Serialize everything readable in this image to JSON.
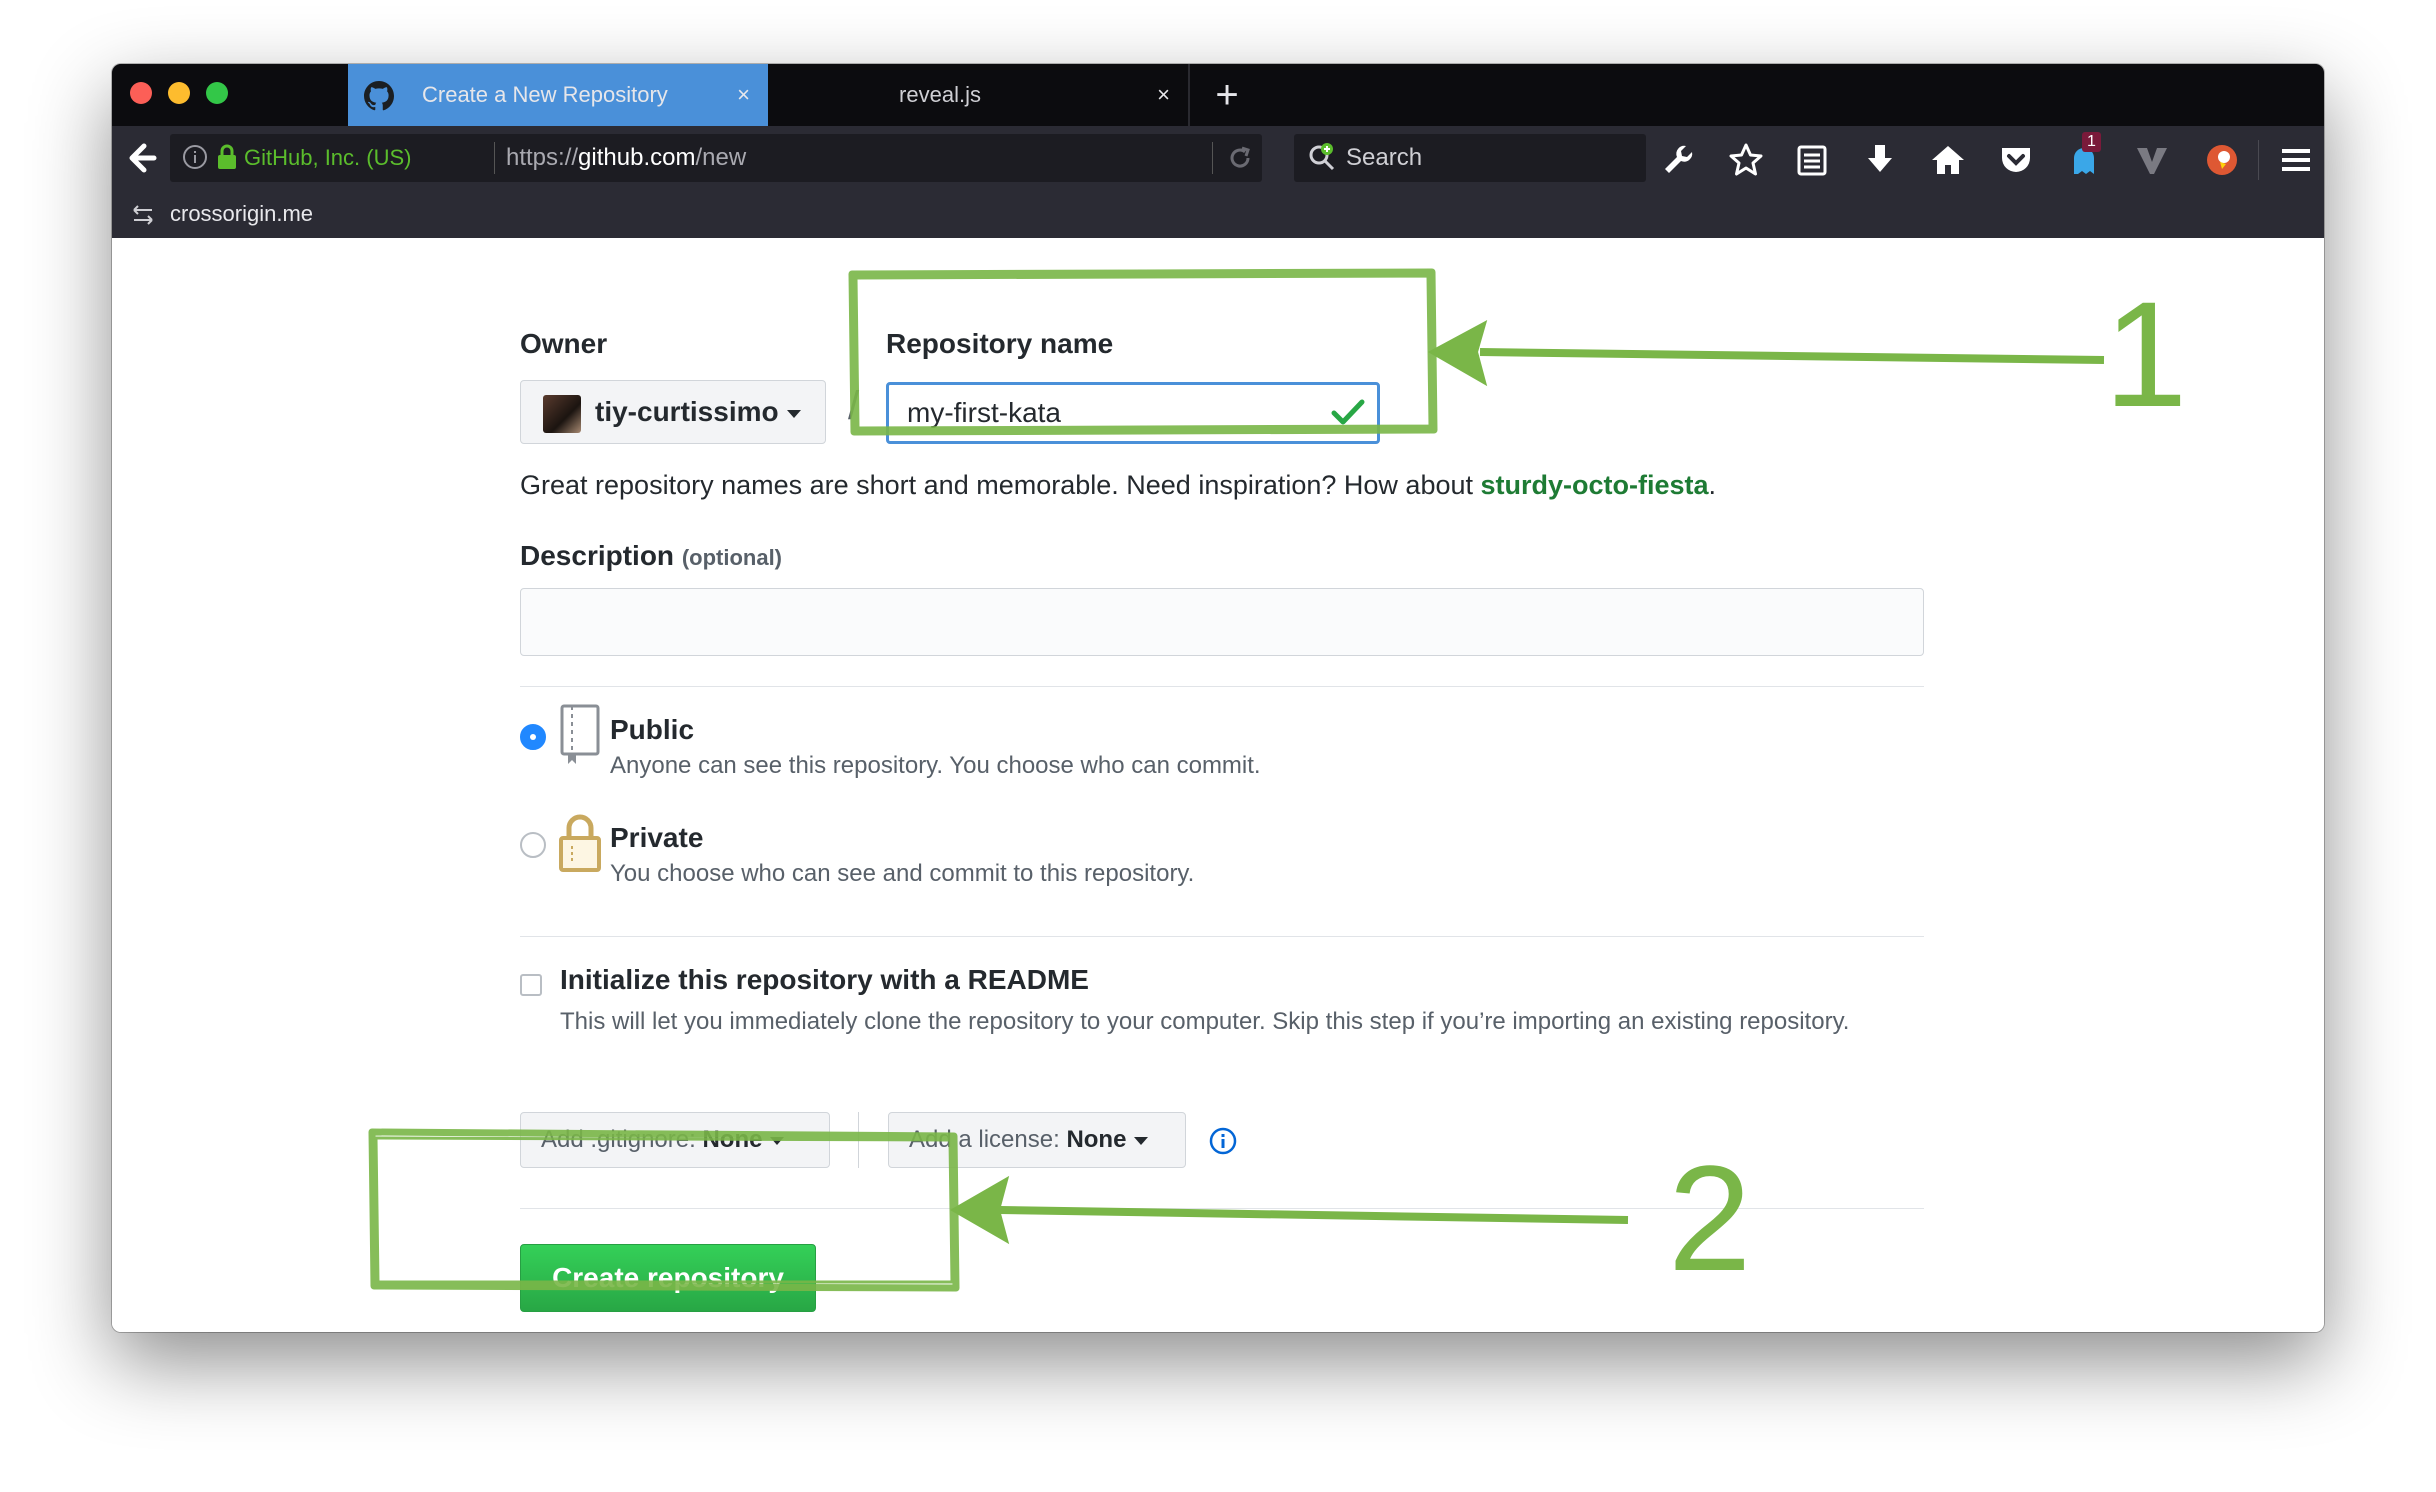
{
  "browser": {
    "tabs": [
      {
        "title": "Create a New Repository",
        "active": true,
        "close": "×"
      },
      {
        "title": "reveal.js",
        "active": false,
        "close": "×"
      }
    ],
    "new_tab": "+",
    "url": {
      "identity": "GitHub, Inc. (US)",
      "prefix": "https://",
      "domain": "github.com",
      "path": "/new"
    },
    "search_placeholder": "Search",
    "badge_count": "1",
    "bookmark": "crossorigin.me"
  },
  "form": {
    "owner_label": "Owner",
    "owner_value": "tiy-curtissimo",
    "slash": "/",
    "repo_label": "Repository name",
    "repo_value": "my-first-kata",
    "hint_text": "Great repository names are short and memorable. Need inspiration? How about ",
    "hint_suggestion": "sturdy-octo-fiesta",
    "hint_end": ".",
    "description_label": "Description",
    "description_optional": "(optional)",
    "description_value": "",
    "visibility": [
      {
        "title": "Public",
        "desc": "Anyone can see this repository. You choose who can commit.",
        "selected": true
      },
      {
        "title": "Private",
        "desc": "You choose who can see and commit to this repository.",
        "selected": false
      }
    ],
    "init_title": "Initialize this repository with a README",
    "init_desc": "This will let you immediately clone the repository to your computer. Skip this step if you’re importing an existing repository.",
    "gitignore_label": "Add .gitignore:",
    "gitignore_value": "None",
    "license_label": "Add a license:",
    "license_value": "None",
    "create_button": "Create repository"
  },
  "annotations": {
    "step1": "1",
    "step2": "2",
    "color": "#7ab648"
  },
  "colors": {
    "active_tab": "#4a90d9",
    "ev_green": "#5bbd2c",
    "create_green": "#28a745",
    "radio_blue": "#2188ff"
  }
}
